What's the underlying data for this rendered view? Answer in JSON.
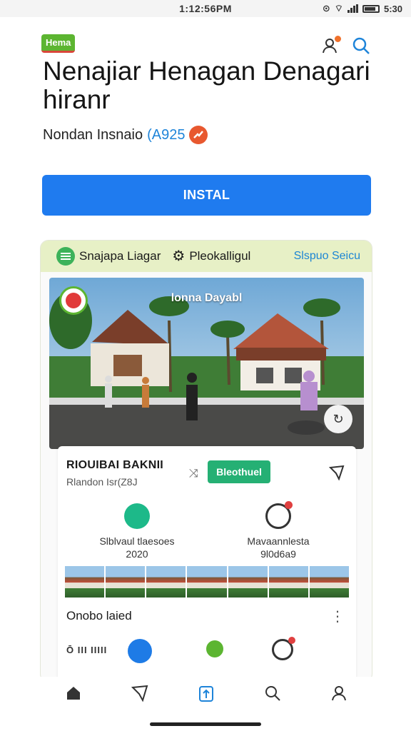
{
  "status_bar": {
    "time": "1:12:56PM",
    "clock_right": "5:30"
  },
  "badge": "Hema",
  "header": {
    "title": "Nenajiar Henagan Denagari hiranr",
    "subtitle_text": "Nondan Insnaio",
    "subtitle_year": "(A925"
  },
  "install_label": "INSTAL",
  "card": {
    "header_left": "Snajapa Liagar",
    "header_mid": "Pleokalligul",
    "header_link": "Slspuo Seicu",
    "photo_caption": "lonna Dayabl",
    "name": "RIOUIBAI BAKNII",
    "location": "Rlandon Isr(Z8J",
    "detail_button": "Bleothuel",
    "stats": [
      {
        "line1": "Slblvaul tlaesoes",
        "line2": "2020"
      },
      {
        "line1": "Mavaannlesta",
        "line2": "9l0d6a9"
      }
    ],
    "online_label": "Onobo laied",
    "camera_strip": "Ō III IIIII"
  },
  "nav": [
    "home-icon",
    "send-icon",
    "upload-icon",
    "search-icon",
    "profile-icon"
  ],
  "colors": {
    "primary": "#1f7bef",
    "green": "#5cb531",
    "header_bg": "#e7f0c6"
  }
}
